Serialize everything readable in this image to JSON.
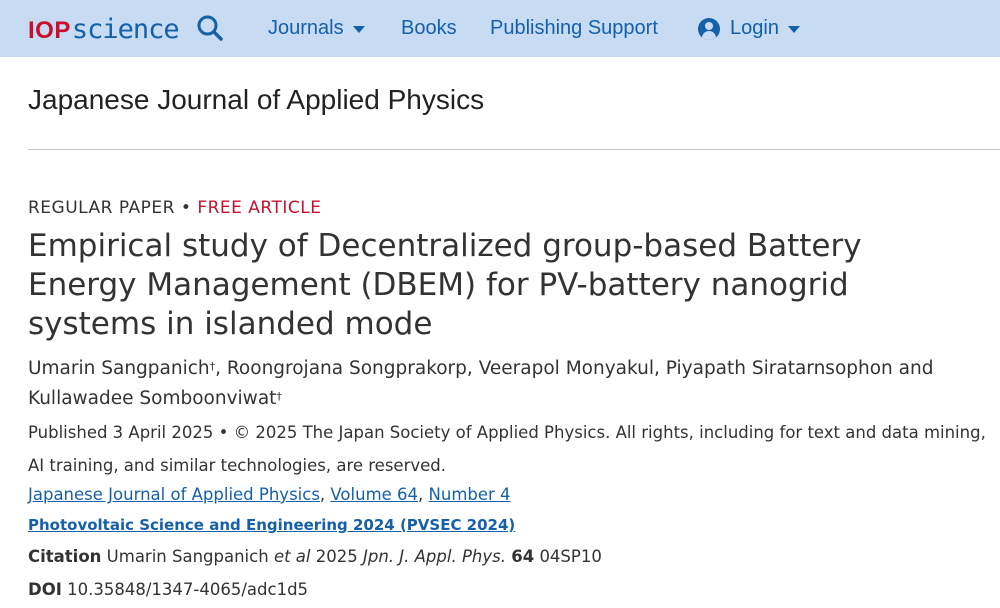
{
  "header": {
    "logo_iop": "IOP",
    "logo_science": "science",
    "nav": {
      "journals": "Journals",
      "books": "Books",
      "publishing_support": "Publishing Support",
      "login": "Login"
    }
  },
  "journal": {
    "title": "Japanese Journal of Applied Physics"
  },
  "article": {
    "type": "REGULAR PAPER",
    "separator": "•",
    "access": "FREE ARTICLE",
    "title": "Empirical study of Decentralized group-based Battery Energy Management (DBEM) for PV-battery nanogrid systems in islanded mode",
    "authors": [
      {
        "name": "Umarin Sangpanich",
        "mark": "†",
        "after": ", "
      },
      {
        "name": "Roongrojana Songprakorp",
        "mark": "",
        "after": ", "
      },
      {
        "name": "Veerapol Monyakul",
        "mark": "",
        "after": ", "
      },
      {
        "name": "Piyapath Siratarnsophon",
        "mark": "",
        "after": " and "
      },
      {
        "name": "Kullawadee Somboonviwat",
        "mark": "†",
        "after": ""
      }
    ],
    "published": "Published 3 April 2025 • © 2025 The Japan Society of Applied Physics. All rights, including for text and data mining, AI training, and similar technologies, are reserved.",
    "journal_link": "Japanese Journal of Applied Physics",
    "volume_link": "Volume 64",
    "number_link": "Number 4",
    "link_separator": ", ",
    "conference_link": "Photovoltaic Science and Engineering 2024 (PVSEC 2024)",
    "citation": {
      "label": "Citation",
      "authors": "Umarin Sangpanich",
      "etal": "et al",
      "year": "2025",
      "journal_abbrev": "Jpn. J. Appl. Phys.",
      "volume": "64",
      "article_no": "04SP10"
    },
    "doi": {
      "label": "DOI",
      "value": "10.35848/1347-4065/adc1d5"
    }
  },
  "colors": {
    "topbar": "#c7dbf2",
    "link": "#1560a8",
    "accent_red": "#c8102e"
  }
}
